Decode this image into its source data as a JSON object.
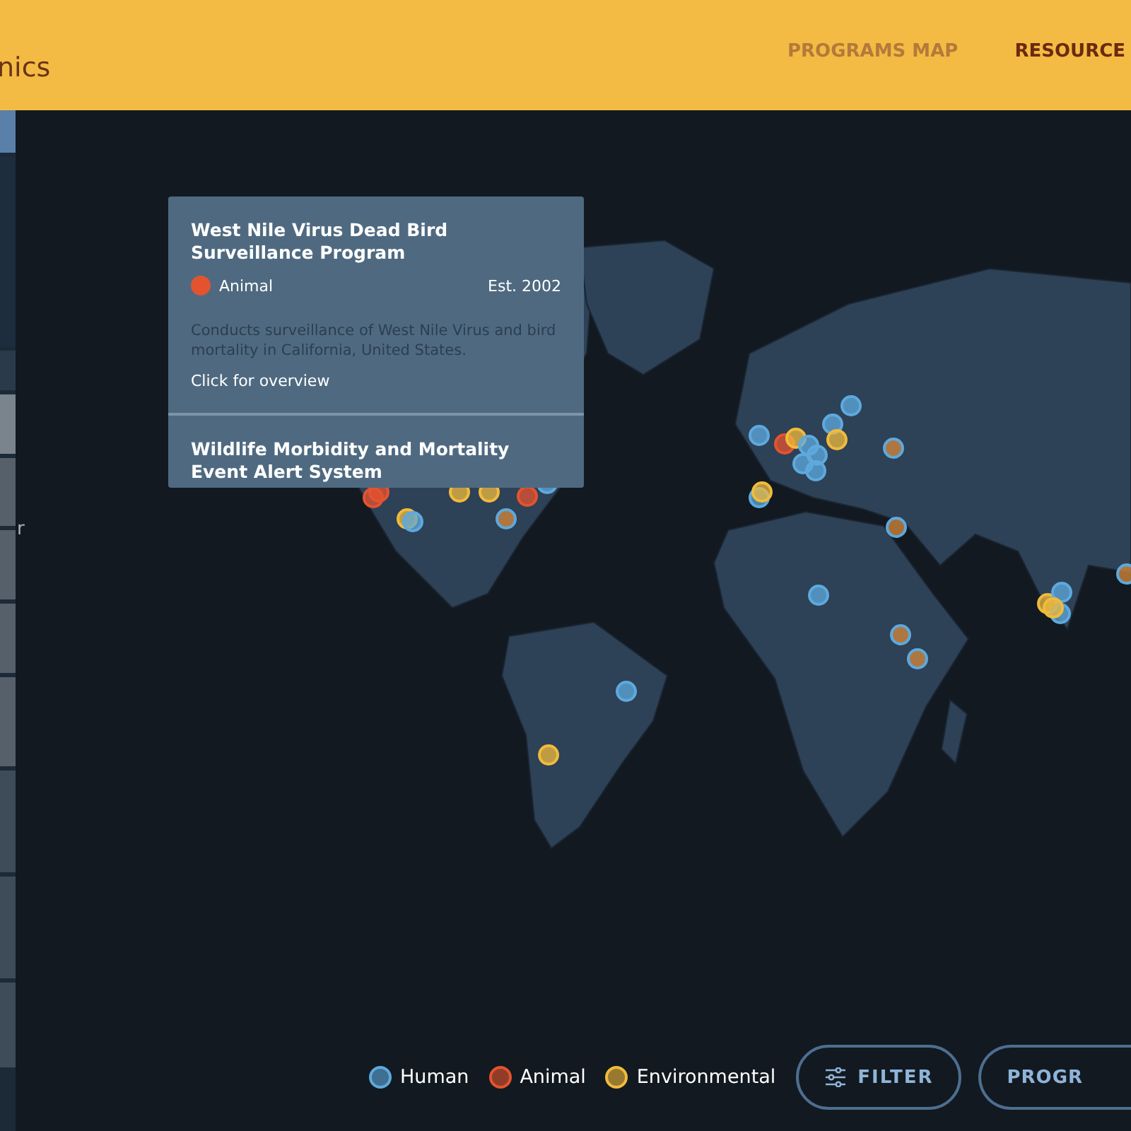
{
  "header": {
    "logo_fragment": "nics",
    "nav": [
      {
        "label": "PROGRAMS MAP",
        "selected": false
      },
      {
        "label": "RESOURCE",
        "selected": true
      }
    ]
  },
  "sidebar": {
    "text_fragment": "r"
  },
  "tooltip": {
    "programs": [
      {
        "title": "West Nile Virus Dead Bird Surveillance Program",
        "category": "Animal",
        "color": "#e4532f",
        "established": "Est. 2002",
        "description": "Conducts surveillance of West Nile Virus and bird mortality in California, United States.",
        "link": "Click for overview"
      },
      {
        "title": "Wildlife Morbidity and Mortality Event Alert System"
      }
    ]
  },
  "legend": [
    {
      "label": "Human",
      "color": "#5ea9dd"
    },
    {
      "label": "Animal",
      "color": "#e4532f"
    },
    {
      "label": "Environmental",
      "color": "#f0bb3c"
    }
  ],
  "buttons": [
    {
      "kind": "filter",
      "label": "FILTER"
    },
    {
      "kind": "plain",
      "label": "PROGR"
    }
  ]
}
